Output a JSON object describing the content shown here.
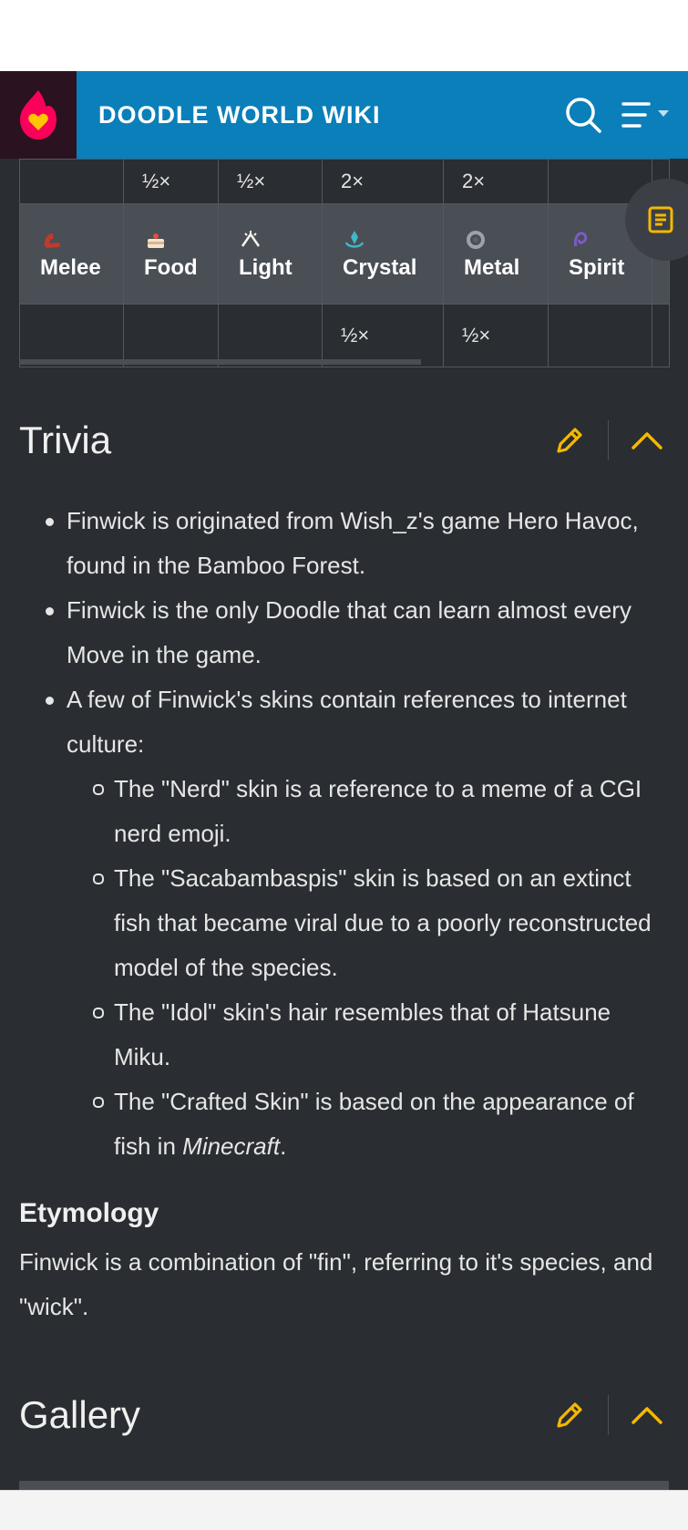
{
  "header": {
    "site_title": "DOODLE WORLD WIKI",
    "logo_icon": "fandom-heart-logo-icon",
    "search_icon": "search-icon",
    "menu_icon": "hamburger-menu-icon",
    "colors": {
      "bar": "#0a7fba",
      "logo_bg": "#2a1220",
      "logo_flame": "#fa005a",
      "logo_heart": "#ffc500"
    }
  },
  "type_table": {
    "top_row": [
      "",
      "½×",
      "½×",
      "2×",
      "2×",
      "",
      ""
    ],
    "types": [
      {
        "label": "Melee",
        "icon": "melee-type-icon"
      },
      {
        "label": "Food",
        "icon": "food-type-icon"
      },
      {
        "label": "Light",
        "icon": "light-type-icon"
      },
      {
        "label": "Crystal",
        "icon": "crystal-type-icon"
      },
      {
        "label": "Metal",
        "icon": "metal-type-icon"
      },
      {
        "label": "Spirit",
        "icon": "spirit-type-icon"
      }
    ],
    "bottom_row": [
      "",
      "",
      "",
      "½×",
      "½×",
      "",
      ""
    ]
  },
  "toc_button": {
    "icon": "table-of-contents-icon",
    "accent": "#f5b800"
  },
  "trivia": {
    "title": "Trivia",
    "items": [
      "Finwick is originated from Wish_z's game Hero Havoc, found in the Bamboo Forest.",
      "Finwick is the only Doodle that can learn almost every Move in the game.",
      "A few of Finwick's skins contain references to internet culture:"
    ],
    "sub_items": [
      "The \"Nerd\" skin is a reference to a meme of a CGI nerd emoji.",
      "The \"Sacabambaspis\" skin is based on an extinct fish that became viral due to a poorly reconstructed model of the species.",
      "The \"Idol\" skin's hair resembles that of Hatsune Miku."
    ],
    "last_sub": {
      "before": "The \"Crafted Skin\" is based on the appearance of fish in ",
      "italic": "Minecraft",
      "after": "."
    }
  },
  "etymology": {
    "title": "Etymology",
    "text": "Finwick is a combination of \"fin\", referring to it's species, and \"wick\"."
  },
  "gallery": {
    "title": "Gallery"
  },
  "section_controls": {
    "edit_icon": "pencil-edit-icon",
    "collapse_icon": "chevron-up-icon",
    "accent": "#f5b800"
  }
}
